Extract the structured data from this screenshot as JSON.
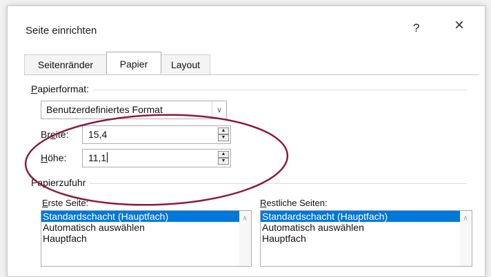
{
  "dialog": {
    "title": "Seite einrichten",
    "help_label": "?",
    "close_label": "×"
  },
  "tabs": [
    {
      "label": "Seitenränder",
      "active": false
    },
    {
      "label": "Papier",
      "active": true
    },
    {
      "label": "Layout",
      "active": false
    }
  ],
  "paper_format": {
    "group_label_underlined": "P",
    "group_label_rest": "apierformat:",
    "selected": "Benutzerdefiniertes Format",
    "width_label_a": "Br",
    "width_label_u": "e",
    "width_label_b": "ite:",
    "width_value": "15,4",
    "height_label_u": "H",
    "height_label_rest": "öhe:",
    "height_value": "11,1"
  },
  "paper_source": {
    "group_label": "Papierzufuhr",
    "first_label_u": "E",
    "first_label_rest": "rste Seite:",
    "other_label_u": "R",
    "other_label_rest": "estliche Seiten:",
    "first_items": [
      "Standardschacht (Hauptfach)",
      "Automatisch auswählen",
      "Hauptfach"
    ],
    "other_items": [
      "Standardschacht (Hauptfach)",
      "Automatisch auswählen",
      "Hauptfach"
    ],
    "selected_index": 0
  },
  "colors": {
    "selection": "#0078d7",
    "annotation_ellipse": "#8b1a3a"
  }
}
